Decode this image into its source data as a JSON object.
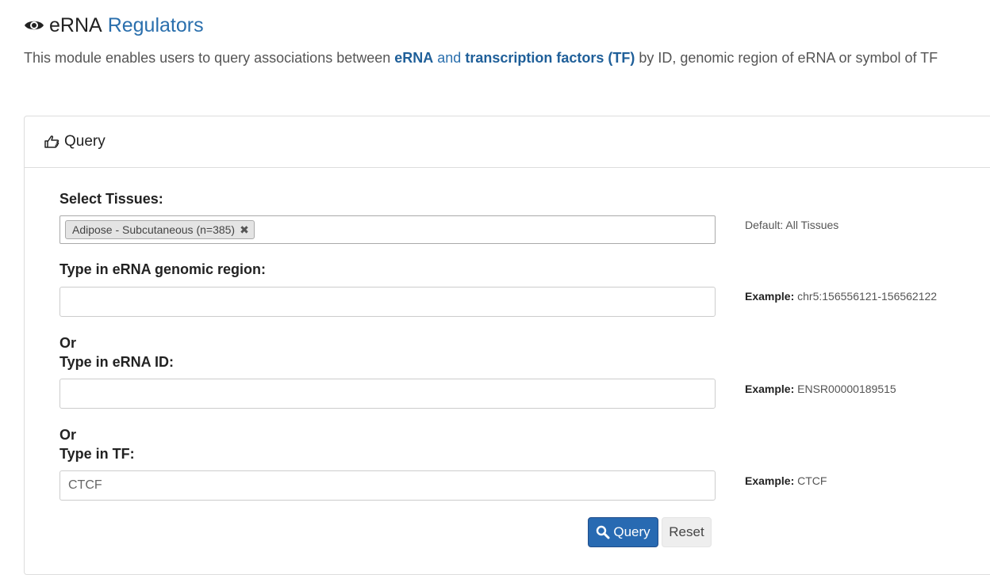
{
  "header": {
    "icon": "eye-icon",
    "title_main": "eRNA",
    "title_accent": "Regulators",
    "subtitle_pre": "This module enables users to query associations between ",
    "subtitle_erna": "eRNA",
    "subtitle_and": " and ",
    "subtitle_tf": "transcription factors (TF)",
    "subtitle_post": " by ID, genomic region of eRNA or symbol of TF"
  },
  "panel": {
    "icon": "hand-pointer-icon",
    "title": "Query"
  },
  "form": {
    "tissues_label": "Select Tissues:",
    "tissue_selected": "Adipose - Subcutaneous (n=385)",
    "tissue_remove": "✖",
    "tissues_hint": "Default: All Tissues",
    "region_label": "Type in eRNA genomic region:",
    "region_value": "",
    "region_hint_label": "Example:",
    "region_hint_value": " chr5:156556121-156562122",
    "or1": "Or",
    "id_label": "Type in eRNA ID:",
    "id_value": "",
    "id_hint_label": "Example:",
    "id_hint_value": " ENSR00000189515",
    "or2": "Or",
    "tf_label": "Type in TF:",
    "tf_value": "CTCF",
    "tf_hint_label": "Example:",
    "tf_hint_value": " CTCF",
    "query_button": "Query",
    "reset_button": "Reset"
  },
  "colors": {
    "accent": "#2a6fad",
    "primary_button": "#286ab2"
  }
}
